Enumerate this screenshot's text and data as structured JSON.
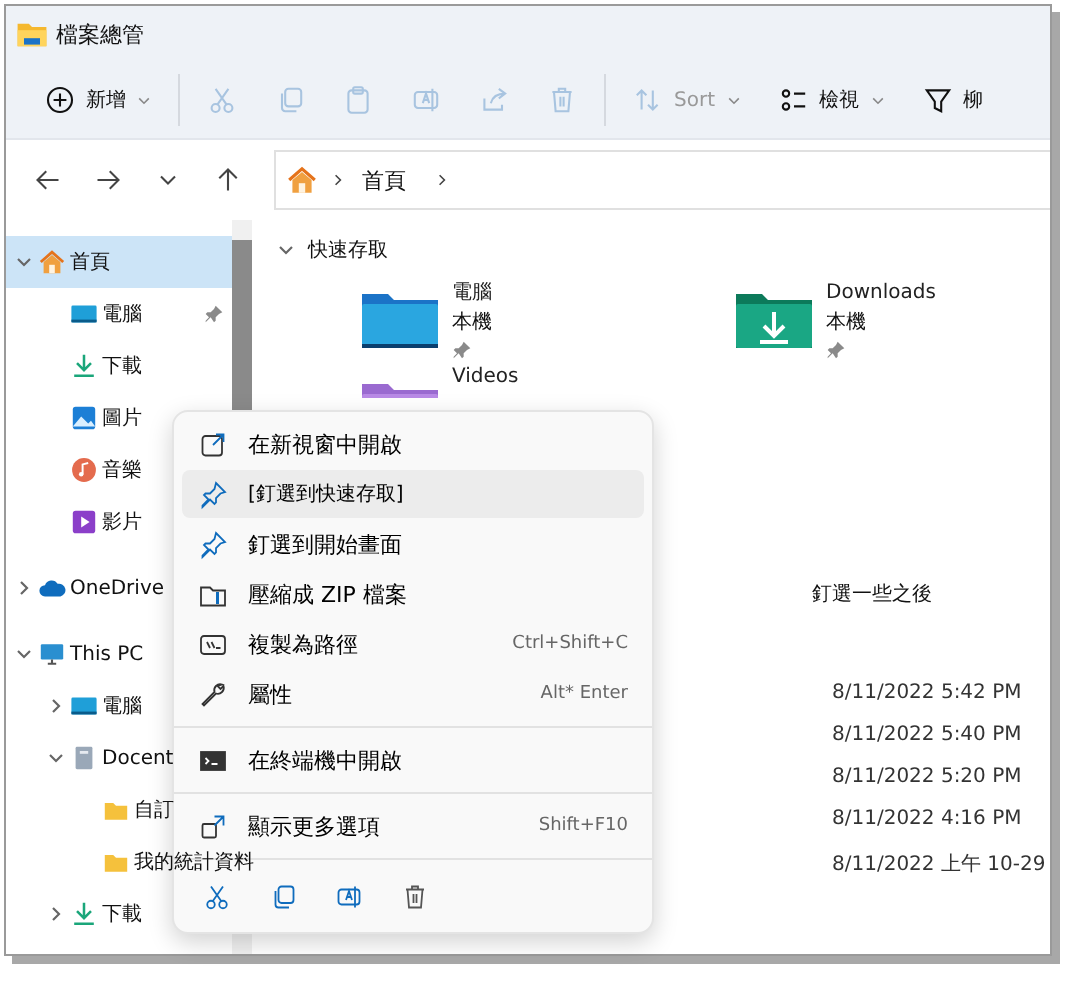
{
  "window": {
    "title": "檔案總管"
  },
  "toolbar": [
    {
      "kind": "new",
      "label": "新增",
      "disabled": false,
      "dropdown": true
    },
    {
      "kind": "cut",
      "disabled": true
    },
    {
      "kind": "copy",
      "disabled": true
    },
    {
      "kind": "paste",
      "disabled": true
    },
    {
      "kind": "rename",
      "disabled": true
    },
    {
      "kind": "share",
      "disabled": true
    },
    {
      "kind": "delete",
      "disabled": true
    },
    {
      "kind": "sort",
      "label": "Sort",
      "disabled": true,
      "dropdown": true
    },
    {
      "kind": "view",
      "label": "檢視",
      "disabled": false,
      "dropdown": true
    },
    {
      "kind": "filter",
      "label": "柳",
      "disabled": false,
      "dropdown": false
    }
  ],
  "address": {
    "crumbs": [
      "首頁"
    ]
  },
  "sidebar": {
    "items": [
      {
        "kind": "home",
        "label": "首頁",
        "selected": true,
        "expanded": true,
        "children": [
          {
            "kind": "desktop",
            "label": "電腦",
            "selected": false,
            "pinned": true
          },
          {
            "kind": "download",
            "label": "下載",
            "selected": false,
            "pinned": false
          },
          {
            "kind": "pictures",
            "label": "圖片",
            "selected": false,
            "pinned": false
          },
          {
            "kind": "music",
            "label": "音樂",
            "selected": false,
            "pinned": false
          },
          {
            "kind": "videos",
            "label": "影片",
            "selected": false,
            "pinned": false
          }
        ]
      },
      {
        "kind": "cloud",
        "label": "OneDrive",
        "selected": false,
        "expanded": false
      },
      {
        "kind": "pc",
        "label": "This PC",
        "selected": false,
        "expanded": true,
        "children": [
          {
            "kind": "desktop",
            "label": "電腦",
            "selected": false,
            "expanded": false
          },
          {
            "kind": "drive",
            "label": "Docent",
            "selected": false,
            "expanded": true,
            "children": [
              {
                "kind": "folder",
                "label": "自訂",
                "selected": false
              },
              {
                "kind": "folder",
                "label": "我的統計資料",
                "selected": false
              }
            ]
          },
          {
            "kind": "download",
            "label": "下載",
            "selected": false,
            "expanded": false
          }
        ]
      }
    ]
  },
  "quick_access": {
    "title": "快速存取",
    "expanded": true,
    "tiles": [
      {
        "kind": "desktop",
        "name": "電腦",
        "location": "本機",
        "pinned": true
      },
      {
        "kind": "download",
        "name": "Downloads",
        "location": "本機",
        "pinned": true
      },
      {
        "kind": "videos",
        "name": "Videos"
      }
    ]
  },
  "recent": {
    "heading": "釘選一些之後",
    "dates": [
      "8/11/2022 5:42 PM",
      "8/11/2022 5:40 PM",
      "8/11/2022 5:20 PM",
      "8/11/2022 4:16 PM",
      "8/11/2022 上午 10-29"
    ]
  },
  "context_menu": {
    "items": [
      {
        "kind": "item",
        "label": "在新視窗中開啟",
        "selected": false
      },
      {
        "kind": "item",
        "label": "[釘選到快速存取]",
        "selected": true
      },
      {
        "kind": "item",
        "label": "釘選到開始畫面",
        "selected": false
      },
      {
        "kind": "item",
        "label": "壓縮成 ZIP 檔案",
        "selected": false
      },
      {
        "kind": "item",
        "label": "複製為路徑",
        "shortcut": "Ctrl+Shift+C",
        "selected": false
      },
      {
        "kind": "item",
        "label": "屬性",
        "shortcut": "Alt* Enter",
        "selected": false
      },
      {
        "kind": "separator"
      },
      {
        "kind": "item",
        "label": "在終端機中開啟",
        "selected": false
      },
      {
        "kind": "separator"
      },
      {
        "kind": "item",
        "label": "顯示更多選項",
        "shortcut": "Shift+F10",
        "selected": false
      },
      {
        "kind": "separator"
      }
    ],
    "actions": [
      {
        "kind": "cut"
      },
      {
        "kind": "copy"
      },
      {
        "kind": "rename"
      },
      {
        "kind": "delete"
      }
    ]
  }
}
